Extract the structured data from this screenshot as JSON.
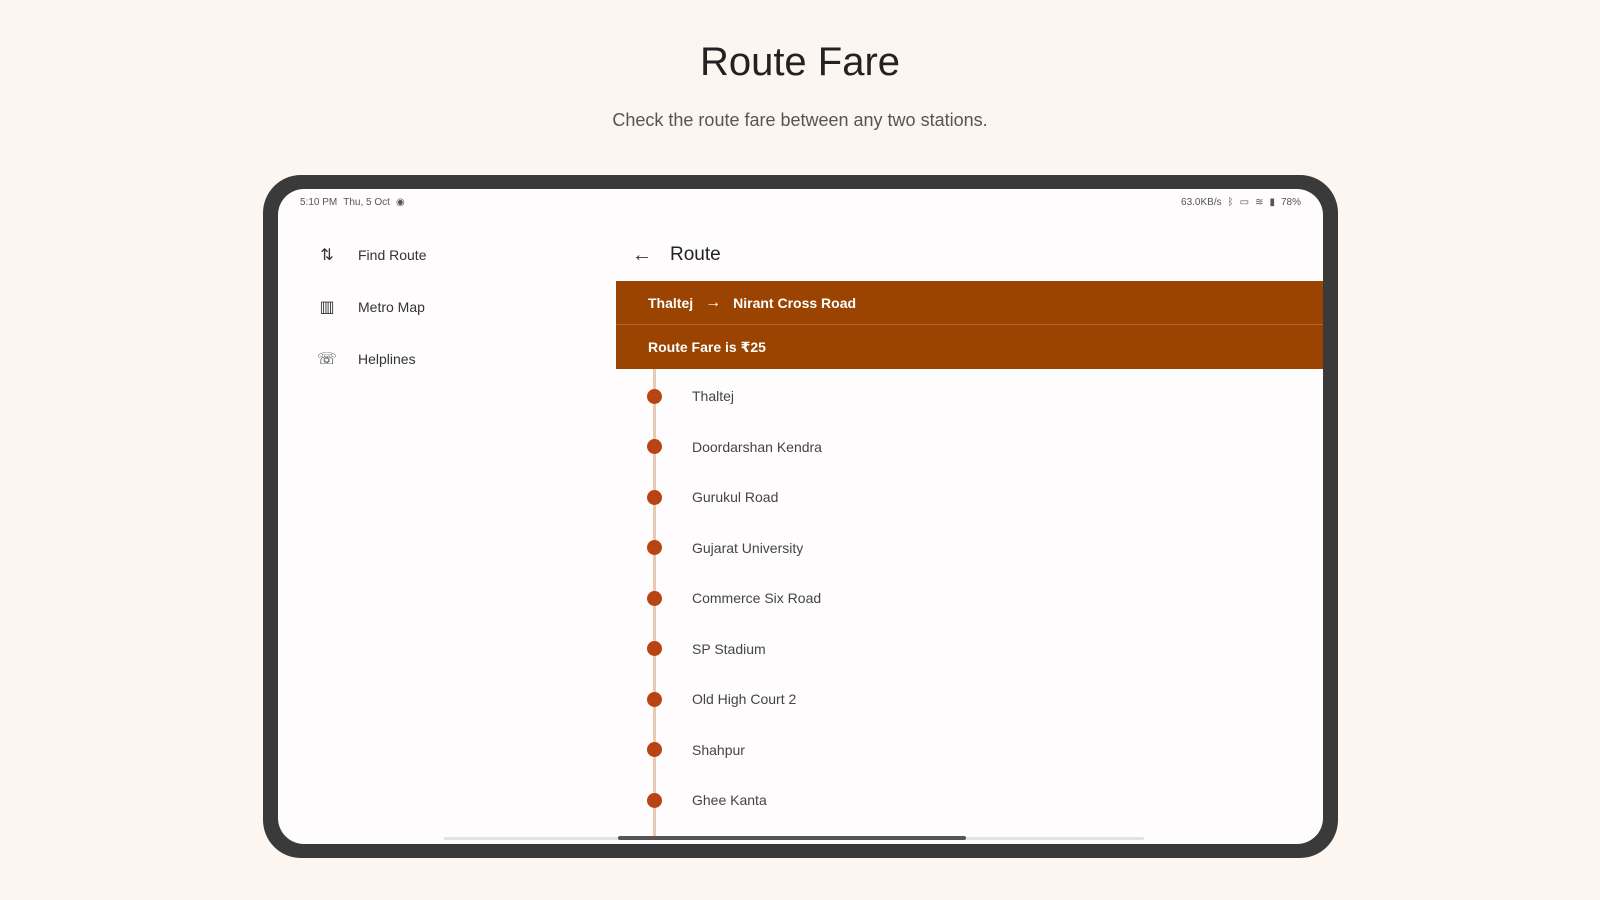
{
  "hero": {
    "title": "Route Fare",
    "subtitle": "Check the route fare between any two stations."
  },
  "status_bar": {
    "time": "5:10 PM",
    "date": "Thu, 5 Oct",
    "network_speed": "63.0KB/s",
    "battery": "78%"
  },
  "sidebar": {
    "items": [
      {
        "label": "Find Route",
        "icon": "route-swap-icon"
      },
      {
        "label": "Metro Map",
        "icon": "map-icon"
      },
      {
        "label": "Helplines",
        "icon": "phone-icon"
      }
    ]
  },
  "route": {
    "title": "Route",
    "from": "Thaltej",
    "to": "Nirant Cross Road",
    "fare_text": "Route Fare is ₹25",
    "stations": [
      "Thaltej",
      "Doordarshan Kendra",
      "Gurukul Road",
      "Gujarat University",
      "Commerce Six Road",
      "SP Stadium",
      "Old High Court 2",
      "Shahpur",
      "Ghee Kanta"
    ]
  },
  "colors": {
    "accent": "#9b4300",
    "station_dot": "#b84414",
    "background": "#fcf5f0"
  }
}
